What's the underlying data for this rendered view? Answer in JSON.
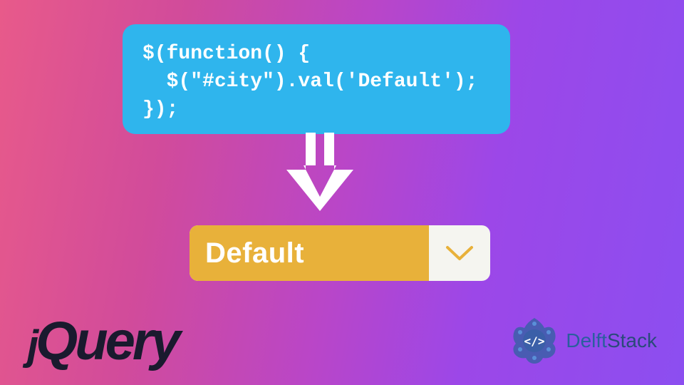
{
  "code": {
    "line1": "$(function() {",
    "line2": "  $(\"#city\").val('Default');",
    "line3": "});"
  },
  "dropdown": {
    "value": "Default"
  },
  "logos": {
    "jquery": "jQuery",
    "delftstack_delft": "Delft",
    "delftstack_stack": "Stack"
  },
  "colors": {
    "code_bg": "#2fb5ed",
    "dropdown_bg": "#e8b13a",
    "dropdown_chevron_bg": "#f5f5f0"
  }
}
